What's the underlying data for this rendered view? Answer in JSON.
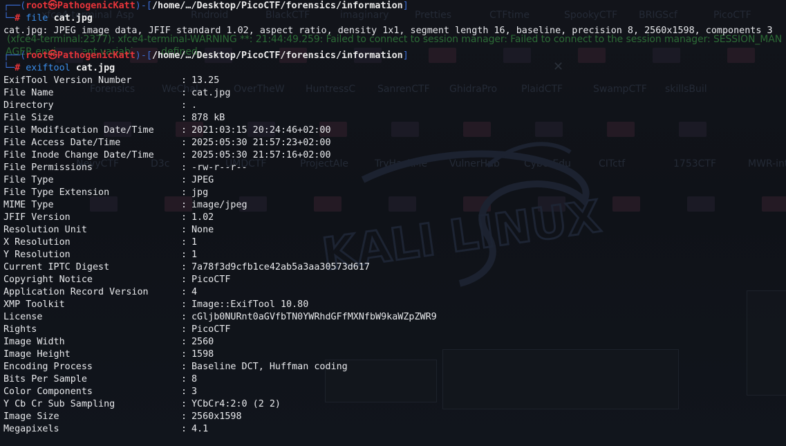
{
  "background": {
    "warning_line_1": "(xfce4-terminal:2377): xfce4-terminal-WARNING **: 21:44:49.259: Failed to connect to session manager: Failed to connect to the session manager: SESSION_MAN",
    "warning_line_2": "AGER environment variable not defined",
    "desktop_row_1": [
      "xfce4-terminal",
      "Asp",
      "Rndroid",
      "BlackCTF",
      "imaginary",
      "Pretties",
      "CTFtime",
      "SpookyCTF",
      "BRIGScf",
      "PicoCTF"
    ],
    "desktop_row_2": [
      "Forensics",
      "WeChal",
      "OverTheW",
      "HuntressC",
      "SanrenCTF",
      "GhidraPro",
      "PlaidCTF",
      "SwampCTF",
      "skillsBuil"
    ],
    "desktop_row_3": [
      "NevyCTF",
      "D3c",
      "UMDCTF",
      "ProjectAle",
      "TryHackMe",
      "VulnerHub",
      "CyberEdu",
      "CITctf",
      "1753CTF",
      "MWR-int"
    ],
    "logo_text": "KALI LINUX",
    "accent_prompt": "#e8343a",
    "accent_corner": "#3b6fd8"
  },
  "terminal": {
    "prompt_1": {
      "user": "root㉿PathogenicKatt",
      "path": "/home/…/Desktop/PicoCTF/forensics/information",
      "command": "file",
      "argument": "cat.jpg"
    },
    "file_output": "cat.jpg: JPEG image data, JFIF standard 1.02, aspect ratio, density 1x1, segment length 16, baseline, precision 8, 2560x1598, components 3",
    "prompt_2": {
      "user": "root㉿PathogenicKatt",
      "path": "/home/…/Desktop/PicoCTF/forensics/information",
      "command": "exiftool",
      "argument": "cat.jpg"
    },
    "exif": [
      {
        "key": "ExifTool Version Number",
        "value": "13.25"
      },
      {
        "key": "File Name",
        "value": "cat.jpg"
      },
      {
        "key": "Directory",
        "value": "."
      },
      {
        "key": "File Size",
        "value": "878 kB"
      },
      {
        "key": "File Modification Date/Time",
        "value": "2021:03:15 20:24:46+02:00"
      },
      {
        "key": "File Access Date/Time",
        "value": "2025:05:30 21:57:23+02:00"
      },
      {
        "key": "File Inode Change Date/Time",
        "value": "2025:05:30 21:57:16+02:00"
      },
      {
        "key": "File Permissions",
        "value": "-rw-r--r--"
      },
      {
        "key": "File Type",
        "value": "JPEG"
      },
      {
        "key": "File Type Extension",
        "value": "jpg"
      },
      {
        "key": "MIME Type",
        "value": "image/jpeg"
      },
      {
        "key": "JFIF Version",
        "value": "1.02"
      },
      {
        "key": "Resolution Unit",
        "value": "None"
      },
      {
        "key": "X Resolution",
        "value": "1"
      },
      {
        "key": "Y Resolution",
        "value": "1"
      },
      {
        "key": "Current IPTC Digest",
        "value": "7a78f3d9cfb1ce42ab5a3aa30573d617"
      },
      {
        "key": "Copyright Notice",
        "value": "PicoCTF"
      },
      {
        "key": "Application Record Version",
        "value": "4"
      },
      {
        "key": "XMP Toolkit",
        "value": "Image::ExifTool 10.80"
      },
      {
        "key": "License",
        "value": "cGljb0NURnt0aGVfbTN0YWRhdGFfMXNfbW9kaWZpZWR9"
      },
      {
        "key": "Rights",
        "value": "PicoCTF"
      },
      {
        "key": "Image Width",
        "value": "2560"
      },
      {
        "key": "Image Height",
        "value": "1598"
      },
      {
        "key": "Encoding Process",
        "value": "Baseline DCT, Huffman coding"
      },
      {
        "key": "Bits Per Sample",
        "value": "8"
      },
      {
        "key": "Color Components",
        "value": "3"
      },
      {
        "key": "Y Cb Cr Sub Sampling",
        "value": "YCbCr4:2:0 (2 2)"
      },
      {
        "key": "Image Size",
        "value": "2560x1598"
      },
      {
        "key": "Megapixels",
        "value": "4.1"
      }
    ]
  }
}
